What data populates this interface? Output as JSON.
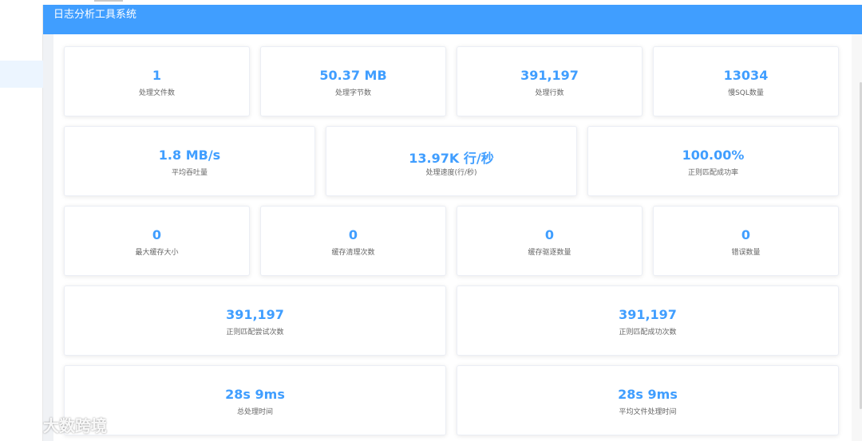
{
  "header": {
    "title": "日志分析工具系统"
  },
  "stats": [
    {
      "value": "1",
      "label": "处理文件数"
    },
    {
      "value": "50.37 MB",
      "label": "处理字节数"
    },
    {
      "value": "391,197",
      "label": "处理行数"
    },
    {
      "value": "13034",
      "label": "慢SQL数量"
    },
    {
      "value": "1.8 MB/s",
      "label": "平均吞吐量"
    },
    {
      "value": "13.97K 行/秒",
      "label": "处理速度(行/秒)"
    },
    {
      "value": "100.00%",
      "label": "正则匹配成功率"
    },
    {
      "value": "0",
      "label": "最大缓存大小"
    },
    {
      "value": "0",
      "label": "缓存清理次数"
    },
    {
      "value": "0",
      "label": "缓存驱逐数量"
    },
    {
      "value": "0",
      "label": "错误数量"
    },
    {
      "value": "391,197",
      "label": "正则匹配尝试次数"
    },
    {
      "value": "391,197",
      "label": "正则匹配成功次数"
    },
    {
      "value": "28s 9ms",
      "label": "总处理时间"
    },
    {
      "value": "28s 9ms",
      "label": "平均文件处理时间"
    }
  ],
  "watermark": {
    "text": "大数跨境"
  },
  "colors": {
    "accent": "#409eff",
    "background": "#f0f2f5"
  }
}
